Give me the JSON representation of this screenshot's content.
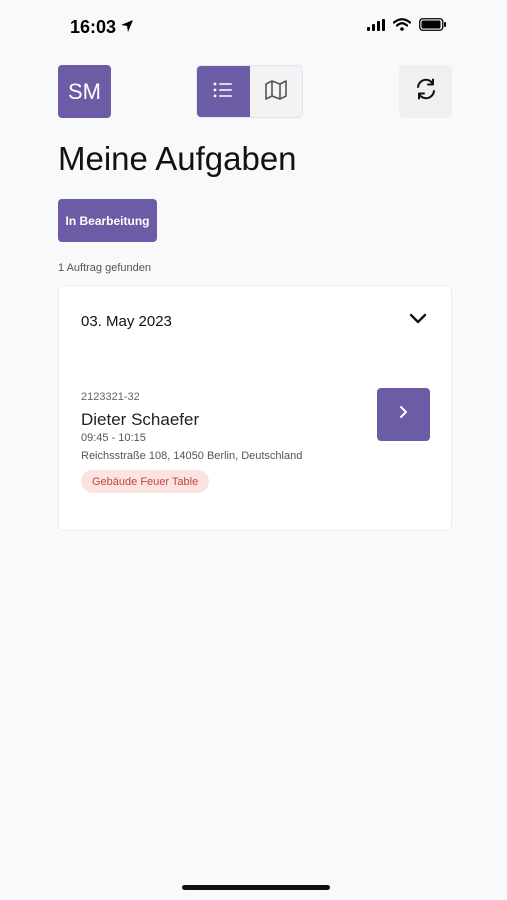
{
  "status_bar": {
    "time": "16:03",
    "icons": [
      "location-arrow-icon",
      "signal-icon",
      "wifi-icon",
      "battery-icon"
    ]
  },
  "header": {
    "avatar_initials": "SM",
    "view_toggle": {
      "options": [
        "list-icon",
        "map-icon"
      ],
      "active": "list-icon"
    },
    "refresh_icon": "refresh-icon"
  },
  "main": {
    "title": "Meine Aufgaben",
    "filter_label": "In Bearbeitung",
    "result_count": "1 Auftrag gefunden",
    "groups": [
      {
        "date": "03. May 2023",
        "expanded": true,
        "tasks": [
          {
            "order_number": "2123321-32",
            "name": "Dieter Schaefer",
            "time": "09:45 - 10:15",
            "address": "Reichsstraße 108, 14050 Berlin, Deutschland",
            "tag": "Gebäude Feuer Table"
          }
        ]
      }
    ]
  },
  "colors": {
    "accent": "#6b5ca5",
    "background": "#f8f9fb",
    "tag_bg": "#fbe3e2",
    "tag_text": "#c4443c"
  }
}
